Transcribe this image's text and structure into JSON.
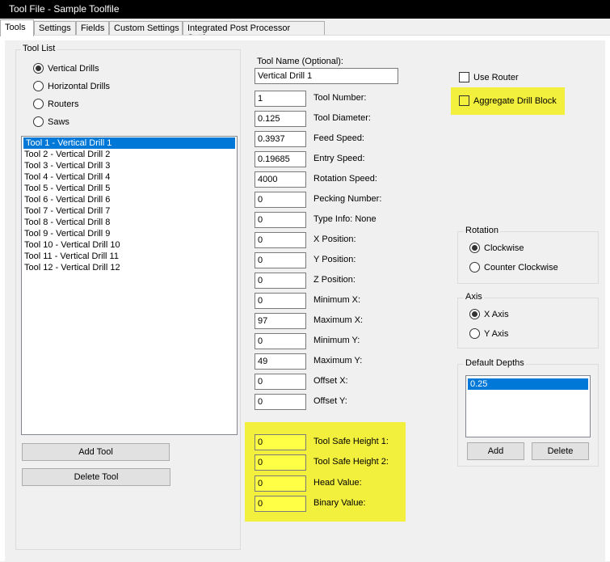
{
  "window": {
    "title": "Tool File - Sample Toolfile"
  },
  "tabs": [
    {
      "label": "Tools"
    },
    {
      "label": "Settings"
    },
    {
      "label": "Fields"
    },
    {
      "label": "Custom Settings"
    },
    {
      "label": "Integrated Post Processor Settings"
    }
  ],
  "tool_list": {
    "title": "Tool List",
    "types": [
      {
        "label": "Vertical Drills",
        "checked": true
      },
      {
        "label": "Horizontal Drills",
        "checked": false
      },
      {
        "label": "Routers",
        "checked": false
      },
      {
        "label": "Saws",
        "checked": false
      }
    ],
    "items": [
      "Tool 1 - Vertical Drill 1",
      "Tool 2 - Vertical Drill 2",
      "Tool 3 - Vertical Drill 3",
      "Tool 4 - Vertical Drill 4",
      "Tool 5 - Vertical Drill 5",
      "Tool 6 - Vertical Drill 6",
      "Tool 7 - Vertical Drill 7",
      "Tool 8 - Vertical Drill 8",
      "Tool 9 - Vertical Drill 9",
      "Tool 10 - Vertical Drill 10",
      "Tool 11 - Vertical Drill 11",
      "Tool 12 - Vertical Drill 12"
    ],
    "selected_index": 0,
    "add_label": "Add Tool",
    "delete_label": "Delete Tool"
  },
  "tool_name": {
    "label": "Tool Name (Optional):",
    "value": "Vertical Drill 1"
  },
  "fields": [
    {
      "label": "Tool Number:",
      "value": "1"
    },
    {
      "label": "Tool Diameter:",
      "value": "0.125"
    },
    {
      "label": "Feed Speed:",
      "value": "0.3937"
    },
    {
      "label": "Entry Speed:",
      "value": "0.19685"
    },
    {
      "label": "Rotation Speed:",
      "value": "4000"
    },
    {
      "label": "Pecking Number:",
      "value": "0"
    },
    {
      "label": "Type Info: None",
      "value": "0"
    },
    {
      "label": "X Position:",
      "value": "0"
    },
    {
      "label": "Y Position:",
      "value": "0"
    },
    {
      "label": "Z Position:",
      "value": "0"
    },
    {
      "label": "Minimum X:",
      "value": "0"
    },
    {
      "label": "Maximum X:",
      "value": "97"
    },
    {
      "label": "Minimum Y:",
      "value": "0"
    },
    {
      "label": "Maximum Y:",
      "value": "49"
    },
    {
      "label": "Offset X:",
      "value": "0"
    },
    {
      "label": "Offset Y:",
      "value": "0"
    }
  ],
  "highlighted_fields": [
    {
      "label": "Tool Safe Height 1:",
      "value": "0"
    },
    {
      "label": "Tool Safe Height 2:",
      "value": "0"
    },
    {
      "label": "Head Value:",
      "value": "0"
    },
    {
      "label": "Binary Value:",
      "value": "0"
    }
  ],
  "options": {
    "use_router": {
      "label": "Use Router",
      "checked": false
    },
    "aggregate_drill_block": {
      "label": "Aggregate Drill Block",
      "checked": false
    }
  },
  "rotation": {
    "title": "Rotation",
    "options": [
      {
        "label": "Clockwise",
        "checked": true
      },
      {
        "label": "Counter Clockwise",
        "checked": false
      }
    ]
  },
  "axis": {
    "title": "Axis",
    "options": [
      {
        "label": "X Axis",
        "checked": true
      },
      {
        "label": "Y Axis",
        "checked": false
      }
    ]
  },
  "default_depths": {
    "title": "Default Depths",
    "items": [
      "0.25"
    ],
    "selected_index": 0,
    "add_label": "Add",
    "delete_label": "Delete"
  },
  "colors": {
    "highlight": "#f2ef3d",
    "field_highlight": "#ffff46",
    "selection": "#0078d7"
  }
}
